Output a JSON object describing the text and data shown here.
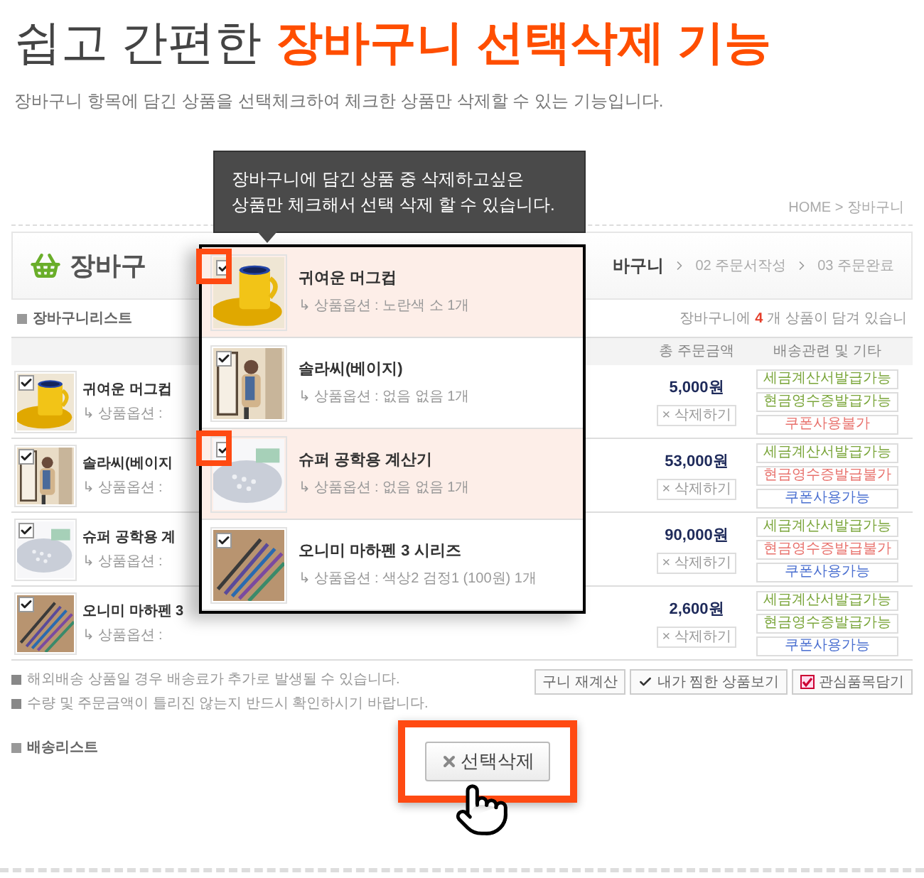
{
  "heading": {
    "lead": "쉽고 간편한",
    "highlight": "장바구니 선택삭제 기능"
  },
  "subtitle": "장바구니 항목에 담긴 상품을 선택체크하여 체크한 상품만 삭제할 수 있는 기능입니다.",
  "shop": {
    "breadcrumb": "HOME > 장바구니",
    "page_title": "장바구",
    "steps": [
      {
        "label": "바구니",
        "selected": true
      },
      {
        "label": "02 주문서작성",
        "selected": false
      },
      {
        "label": "03 주문완료",
        "selected": false
      }
    ],
    "section_label": "장바구니리스트",
    "count_prefix": "장바구니에",
    "count": "4",
    "count_suffix": "개 상품이 담겨 있습니",
    "columns": [
      "총 주문금액",
      "배송관련 및 기타"
    ],
    "rows": [
      {
        "kind": "picture",
        "checked": true,
        "name": "귀여운 머그컵",
        "option": "↳ 상품옵션 :",
        "price": "5,000원",
        "delete": "× 삭제하기",
        "tags": [
          {
            "label": "세금계산서발급가능",
            "color": "#7aa53a"
          },
          {
            "label": "현금영수증발급가능",
            "color": "#7aa53a"
          },
          {
            "label": "쿠폰사용불가",
            "color": "#e8726d"
          }
        ]
      },
      {
        "kind": "picture",
        "checked": true,
        "name": "솔라씨(베이지",
        "option": "↳ 상품옵션 :",
        "price": "53,000원",
        "delete": "× 삭제하기",
        "tags": [
          {
            "label": "세금계산서발급가능",
            "color": "#7aa53a"
          },
          {
            "label": "현금영수증발급불가",
            "color": "#e8726d"
          },
          {
            "label": "쿠폰사용가능",
            "color": "#4a6fd0"
          }
        ]
      },
      {
        "kind": "picture",
        "checked": true,
        "name": "슈퍼 공학용 계",
        "option": "↳ 상품옵션 :",
        "price": "90,000원",
        "delete": "× 삭제하기",
        "tags": [
          {
            "label": "세금계산서발급가능",
            "color": "#7aa53a"
          },
          {
            "label": "현금영수증발급불가",
            "color": "#e8726d"
          },
          {
            "label": "쿠폰사용가능",
            "color": "#4a6fd0"
          }
        ]
      },
      {
        "kind": "picture",
        "checked": true,
        "name": "오니미 마하펜 3",
        "option": "↳ 상품옵션 :",
        "price": "2,600원",
        "delete": "× 삭제하기",
        "tags": [
          {
            "label": "세금계산서발급가능",
            "color": "#7aa53a"
          },
          {
            "label": "현금영수증발급가능",
            "color": "#7aa53a"
          },
          {
            "label": "쿠폰사용가능",
            "color": "#4a6fd0"
          }
        ]
      }
    ],
    "notes": [
      "해외배송 상품일 경우 배송료가 추가로 발생될 수 있습니다.",
      "수량 및 주문금액이 틀리진 않는지 반드시 확인하시기 바랍니다."
    ],
    "buttons": [
      {
        "kind": "plain",
        "label": "구니 재계산"
      },
      {
        "kind": "check",
        "label": "내가 찜한 상품보기"
      },
      {
        "kind": "favorite",
        "label": "관심품목담기"
      }
    ],
    "shipping_label": "배송리스트"
  },
  "tooltip": [
    "장바구니에 담긴 상품 중 삭제하고싶은",
    "상품만 체크해서 선택 삭제 할 수 있습니다."
  ],
  "popup": {
    "items": [
      {
        "checked": true,
        "selected": true,
        "name": "귀여운 머그컵",
        "option": "↳ 상품옵션 : 노란색 소 1개"
      },
      {
        "checked": true,
        "selected": false,
        "name": "솔라씨(베이지)",
        "option": "↳ 상품옵션 : 없음 없음 1개"
      },
      {
        "checked": true,
        "selected": true,
        "name": "슈퍼 공학용 계산기",
        "option": "↳ 상품옵션 : 없음 없음 1개"
      },
      {
        "checked": true,
        "selected": false,
        "name": "오니미 마하펜 3 시리즈",
        "option": "↳ 상품옵션 : 색상2 검정1 (100원) 1개"
      }
    ]
  },
  "delete_selected_button": "선택삭제"
}
